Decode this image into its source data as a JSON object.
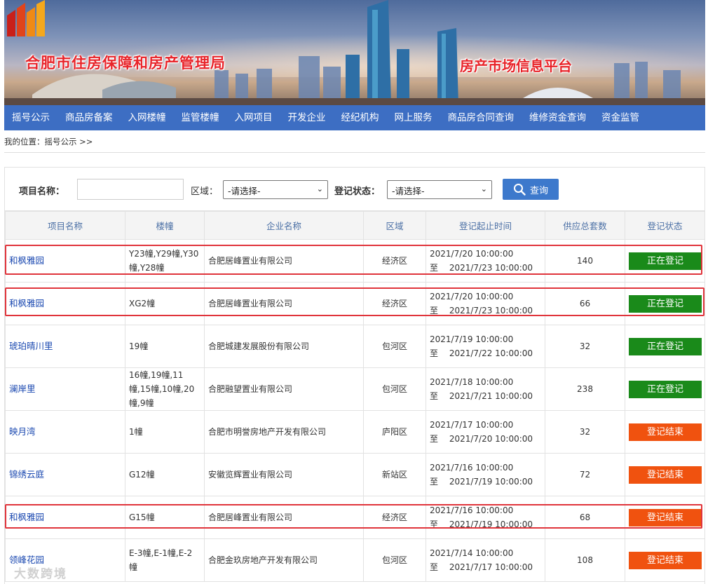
{
  "banner": {
    "title_left": "合肥市住房保障和房产管理局",
    "title_right": "房产市场信息平台"
  },
  "nav": {
    "items": [
      "摇号公示",
      "商品房备案",
      "入网楼幢",
      "监管楼幢",
      "入网项目",
      "开发企业",
      "经纪机构",
      "网上服务",
      "商品房合同查询",
      "维修资金查询",
      "资金监管"
    ]
  },
  "breadcrumb": "我的位置：摇号公示 >>",
  "search": {
    "name_label": "项目名称：",
    "name_value": "",
    "area_label": "区域：",
    "area_selected": "-请选择-",
    "status_label": "登记状态：",
    "status_selected": "-请选择-",
    "button_label": "查询"
  },
  "table": {
    "headers": [
      "项目名称",
      "楼幢",
      "企业名称",
      "区域",
      "登记起止时间",
      "供应总套数",
      "登记状态"
    ],
    "rows": [
      {
        "name": "和枫雅园",
        "buildings": "Y23幢,Y29幢,Y30幢,Y28幢",
        "company": "合肥居峰置业有限公司",
        "area": "经济区",
        "start": "2021/7/20 10:00:00",
        "end": "至　 2021/7/23 10:00:00",
        "total": "140",
        "status": "正在登记",
        "status_type": "open"
      },
      {
        "name": "和枫雅园",
        "buildings": "XG2幢",
        "company": "合肥居峰置业有限公司",
        "area": "经济区",
        "start": "2021/7/20 10:00:00",
        "end": "至　 2021/7/23 10:00:00",
        "total": "66",
        "status": "正在登记",
        "status_type": "open"
      },
      {
        "name": "琥珀晴川里",
        "buildings": "19幢",
        "company": "合肥城建发展股份有限公司",
        "area": "包河区",
        "start": "2021/7/19 10:00:00",
        "end": "至　 2021/7/22 10:00:00",
        "total": "32",
        "status": "正在登记",
        "status_type": "open"
      },
      {
        "name": "澜岸里",
        "buildings": "16幢,19幢,11幢,15幢,10幢,20幢,9幢",
        "company": "合肥融望置业有限公司",
        "area": "包河区",
        "start": "2021/7/18 10:00:00",
        "end": "至　 2021/7/21 10:00:00",
        "total": "238",
        "status": "正在登记",
        "status_type": "open"
      },
      {
        "name": "映月湾",
        "buildings": "1幢",
        "company": "合肥市明誉房地产开发有限公司",
        "area": "庐阳区",
        "start": "2021/7/17 10:00:00",
        "end": "至　 2021/7/20 10:00:00",
        "total": "32",
        "status": "登记结束",
        "status_type": "closed"
      },
      {
        "name": "锦绣云庭",
        "buildings": "G12幢",
        "company": "安徽览辉置业有限公司",
        "area": "新站区",
        "start": "2021/7/16 10:00:00",
        "end": "至　 2021/7/19 10:00:00",
        "total": "72",
        "status": "登记结束",
        "status_type": "closed"
      },
      {
        "name": "和枫雅园",
        "buildings": "G15幢",
        "company": "合肥居峰置业有限公司",
        "area": "经济区",
        "start": "2021/7/16 10:00:00",
        "end": "至　 2021/7/19 10:00:00",
        "total": "68",
        "status": "登记结束",
        "status_type": "closed"
      },
      {
        "name": "领峰花园",
        "buildings": "E-3幢,E-1幢,E-2幢",
        "company": "合肥金玖房地产开发有限公司",
        "area": "包河区",
        "start": "2021/7/14 10:00:00",
        "end": "至　 2021/7/17 10:00:00",
        "total": "108",
        "status": "登记结束",
        "status_type": "closed"
      }
    ]
  },
  "watermark": "大数跨境",
  "colors": {
    "nav_bg": "#3d6ec3",
    "open_status": "#1a8a1a",
    "closed_status": "#f0520f",
    "highlight": "#e0343b",
    "link": "#1a48b0"
  }
}
